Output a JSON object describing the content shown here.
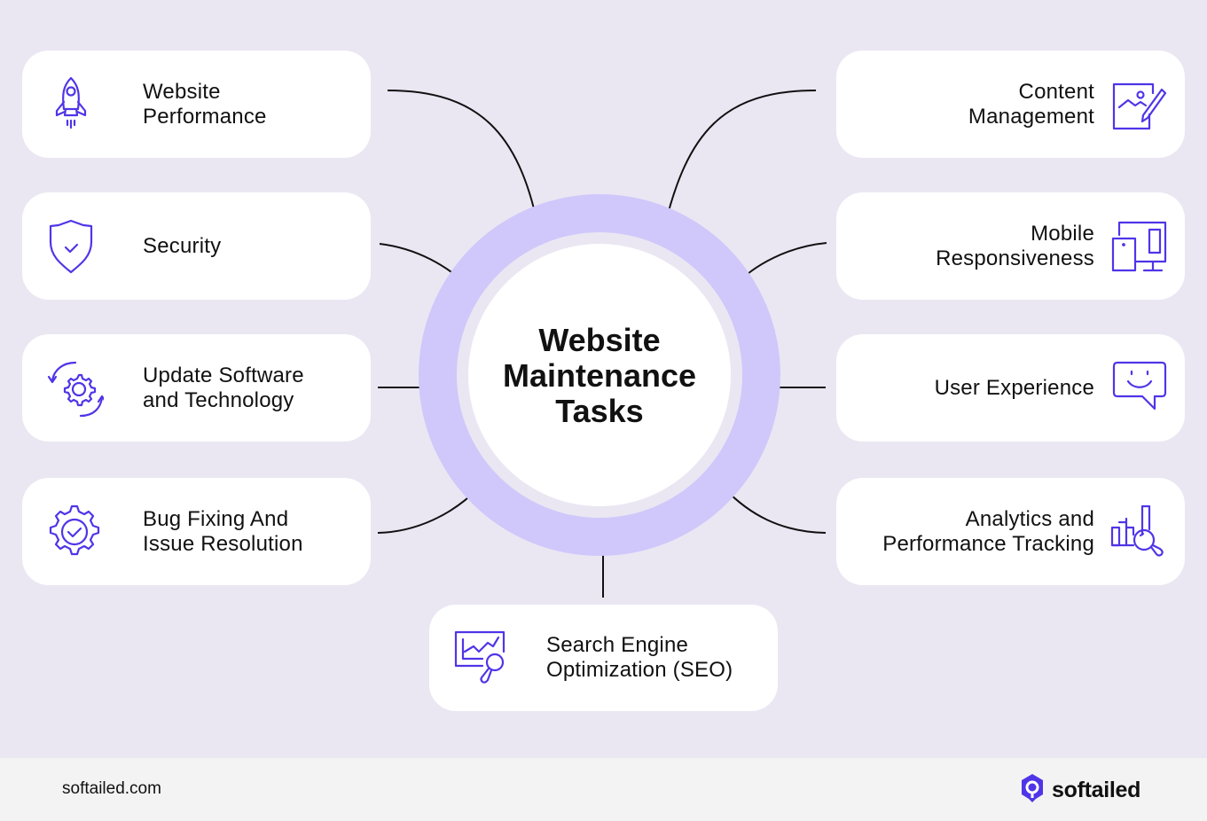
{
  "diagram": {
    "center_title": "Website\nMaintenance\nTasks",
    "accent_color": "#4F35E8",
    "ring_color": "#D0C8FA",
    "background_color": "#EAE7F3",
    "nodes_left": [
      {
        "label": "Website\nPerformance",
        "icon": "rocket-icon"
      },
      {
        "label": "Security",
        "icon": "shield-check-icon"
      },
      {
        "label": "Update Software\nand Technology",
        "icon": "gear-refresh-icon"
      },
      {
        "label": "Bug Fixing And\nIssue Resolution",
        "icon": "gear-check-icon"
      }
    ],
    "nodes_right": [
      {
        "label": "Content\nManagement",
        "icon": "image-edit-icon"
      },
      {
        "label": "Mobile\nResponsiveness",
        "icon": "devices-icon"
      },
      {
        "label": "User Experience",
        "icon": "smile-chat-icon"
      },
      {
        "label": "Analytics and\nPerformance Tracking",
        "icon": "chart-search-icon"
      }
    ],
    "node_bottom": {
      "label": "Search Engine\nOptimization (SEO)",
      "icon": "seo-chart-magnifier-icon"
    }
  },
  "footer": {
    "website": "softailed.com",
    "brand_name": "softailed",
    "brand_icon": "softailed-logo-icon"
  }
}
